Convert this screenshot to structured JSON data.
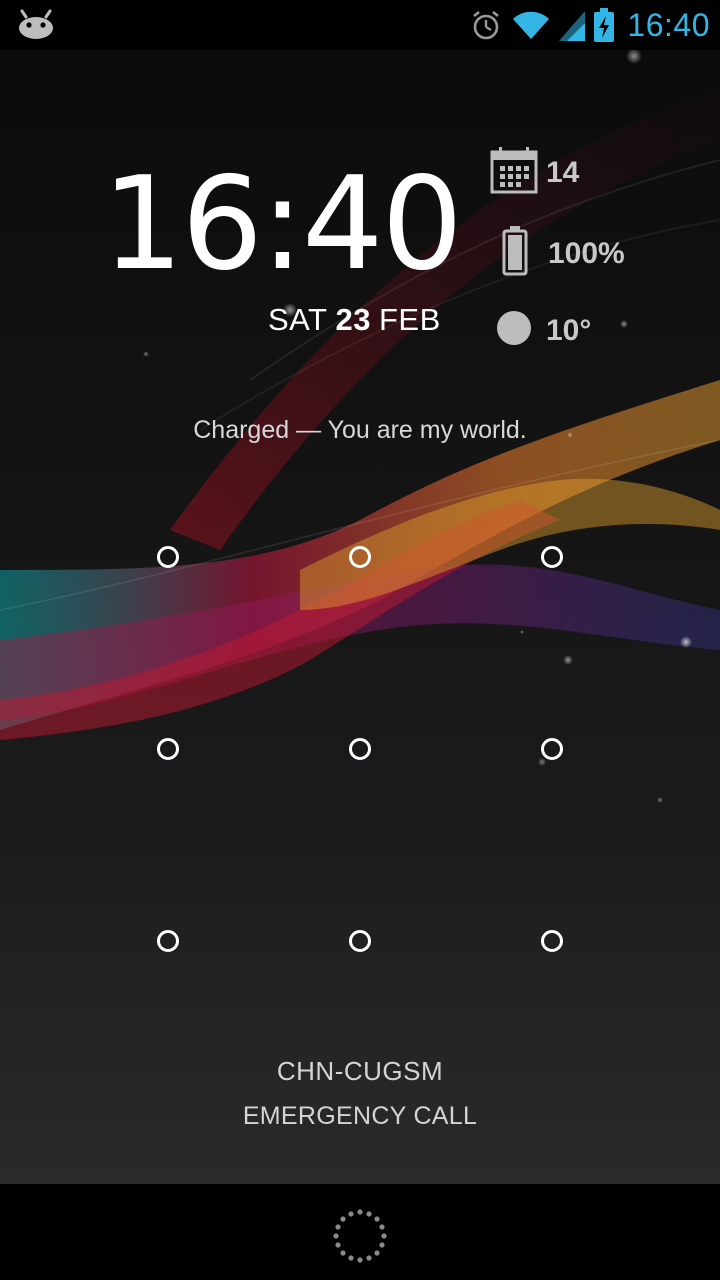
{
  "status_bar": {
    "time": "16:40",
    "icons": [
      "android-icon",
      "alarm-icon",
      "wifi-icon",
      "signal-icon",
      "battery-charging-icon"
    ]
  },
  "lockscreen": {
    "clock": "16:40",
    "date": {
      "weekday": "SAT",
      "day": "23",
      "month": "FEB"
    },
    "widgets": {
      "calendar": "14",
      "battery": "100%",
      "weather": "10°"
    },
    "charge_message": "Charged — You are my world.",
    "carrier": "CHN-CUGSM",
    "emergency_call": "EMERGENCY CALL"
  },
  "colors": {
    "accent": "#33b5e5",
    "background": "#000000",
    "text": "#ffffff"
  }
}
